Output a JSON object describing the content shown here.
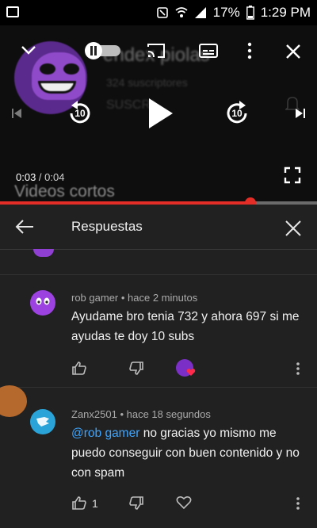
{
  "status_bar": {
    "battery": "17%",
    "time": "1:29 PM"
  },
  "player": {
    "channel_name": "endex piolas",
    "subscribers": "324 suscriptores",
    "subscribe_label": "SUSCRI",
    "section_label": "Videos cortos",
    "time_current": "0:03",
    "time_separator": " / ",
    "time_total": "0:04",
    "skip_back_seconds": "10",
    "skip_forward_seconds": "10",
    "progress_fraction": 0.79
  },
  "panel": {
    "title": "Respuestas"
  },
  "comments": [
    {
      "author": "rob gamer",
      "age": "hace 2 minutos",
      "text": "Ayudame bro tenia 732 y ahora 697 si me ayudas te doy 10 subs",
      "likes": ""
    },
    {
      "author": "Zanx2501",
      "age": "hace 18 segundos",
      "mention": "@rob gamer",
      "text": "no gracias yo mismo me puedo conseguir con buen contenido y no con spam",
      "likes": "1"
    }
  ],
  "colors": {
    "accent": "#e52d27",
    "mention": "#3ea6ff",
    "panel_bg": "#212121"
  }
}
